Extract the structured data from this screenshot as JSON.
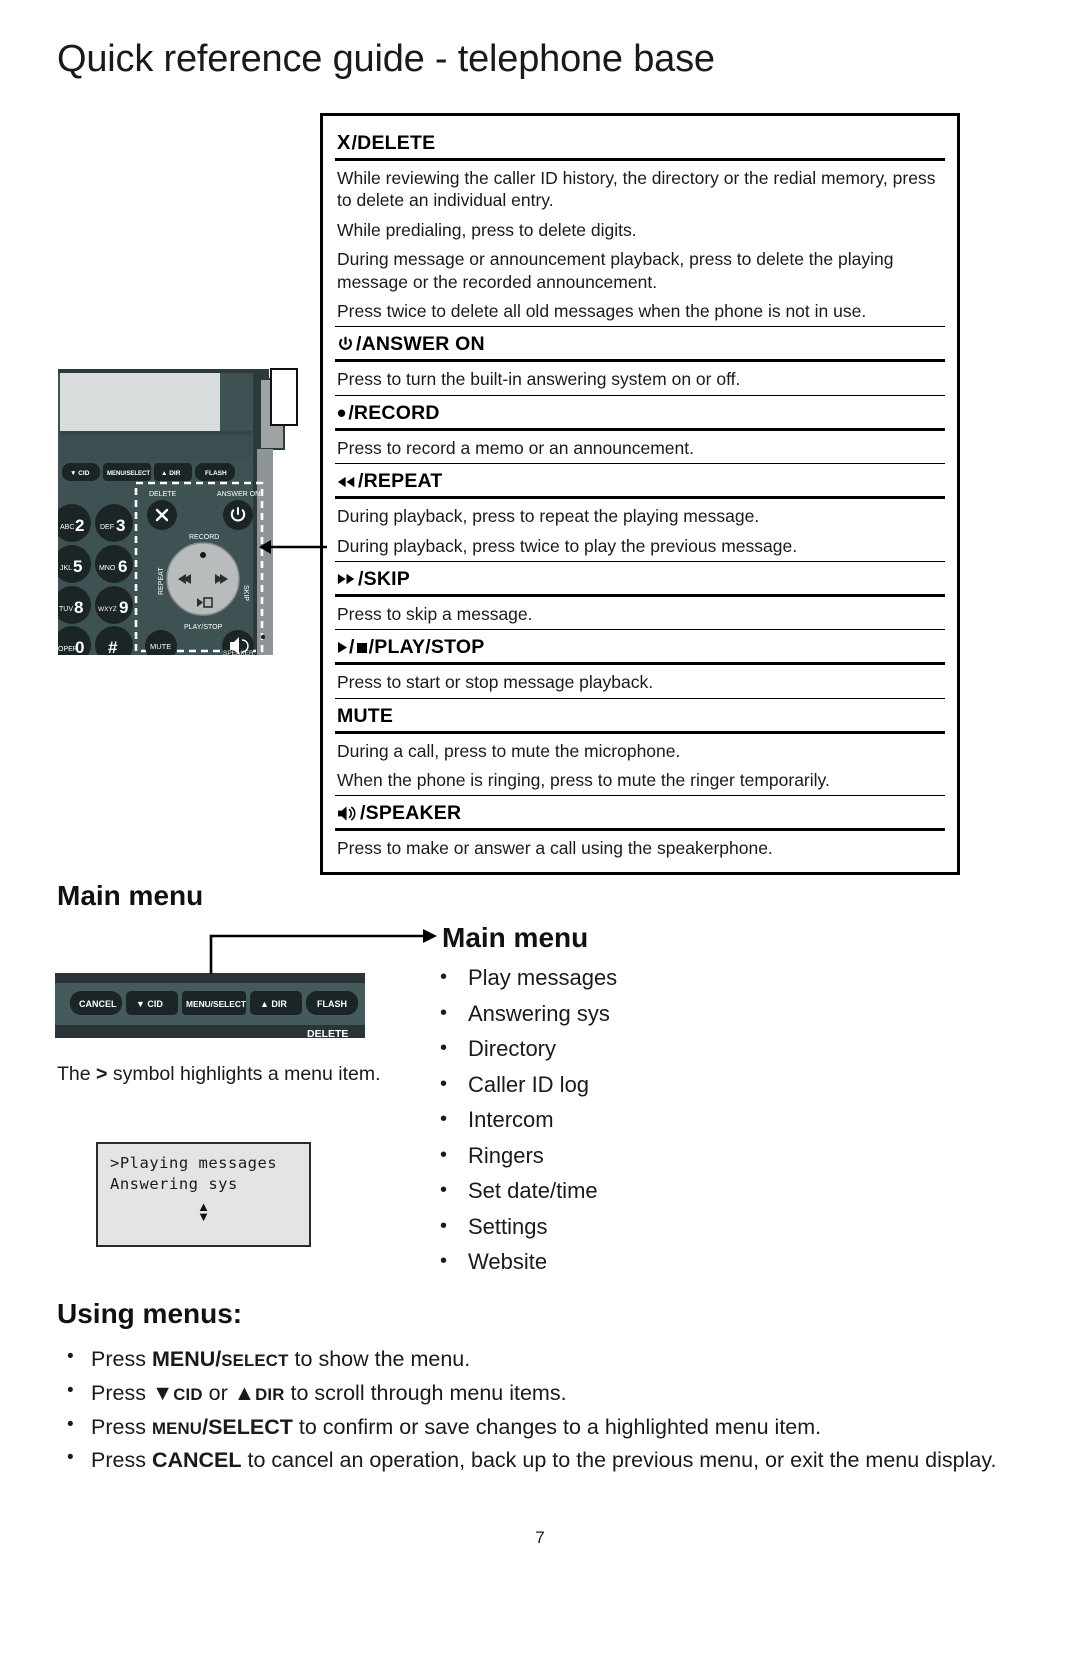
{
  "page": {
    "title": "Quick reference guide - telephone base",
    "number": "7"
  },
  "key_reference": {
    "entries": [
      {
        "icon": "x-delete-icon",
        "symbol": "X",
        "label": "/DELETE",
        "lines": [
          "While reviewing the caller ID history, the directory or the redial memory, press to delete an individual entry.",
          "While predialing, press to delete digits.",
          "During message or announcement playback, press to delete the playing message or the recorded announcement.",
          "Press twice to delete all old messages when the phone is not in use."
        ]
      },
      {
        "icon": "power-icon",
        "symbol": "⏻",
        "label": "/ANSWER ON",
        "lines": [
          "Press to turn the built-in answering system on or off."
        ]
      },
      {
        "icon": "record-dot-icon",
        "symbol": "•",
        "label": "/RECORD",
        "lines": [
          "Press to record a memo or an announcement."
        ]
      },
      {
        "icon": "rewind-icon",
        "symbol": "⏪",
        "label": "/REPEAT",
        "lines": [
          "During playback, press to repeat the playing message.",
          "During playback, press twice to play the previous message."
        ]
      },
      {
        "icon": "fast-forward-icon",
        "symbol": "⏩",
        "label": "/SKIP",
        "lines": [
          "Press to skip a message."
        ]
      },
      {
        "icon": "play-stop-icon",
        "symbol": "▶/■",
        "label": "/PLAY/STOP",
        "lines": [
          "Press to start or stop message playback."
        ]
      },
      {
        "icon": "mute-icon",
        "symbol": "",
        "label": "MUTE",
        "lines": [
          "During a call, press to mute the microphone.",
          "When the phone is ringing, press to mute the ringer temporarily."
        ]
      },
      {
        "icon": "speaker-icon",
        "symbol": "🔊",
        "label": "/SPEAKER",
        "lines": [
          "Press to make or answer a call using the speakerphone."
        ]
      }
    ]
  },
  "phone_illustration": {
    "soft_keys": [
      "▼ CID",
      "MENU/SELECT",
      "▲ DIR",
      "FLASH"
    ],
    "keypad": [
      {
        "digit": "2",
        "letters": "ABC"
      },
      {
        "digit": "3",
        "letters": "DEF"
      },
      {
        "digit": "5",
        "letters": "JKL"
      },
      {
        "digit": "6",
        "letters": "MNO"
      },
      {
        "digit": "8",
        "letters": "TUV"
      },
      {
        "digit": "9",
        "letters": "WXYZ"
      },
      {
        "digit": "0",
        "letters": "OPER"
      },
      {
        "digit": "#",
        "letters": ""
      }
    ],
    "labels": {
      "delete": "DELETE",
      "answer_on": "ANSWER ON",
      "record": "RECORD",
      "repeat": "REPEAT",
      "skip": "SKIP",
      "play_stop": "PLAY/STOP",
      "mute": "MUTE",
      "speaker": "SPEAKER"
    },
    "base_color": "#3e5153",
    "key_color": "#1c2526",
    "ring_color": "#b9bcbd"
  },
  "main_menu_section": {
    "heading": "Main menu",
    "callout_title": "Main menu",
    "items": [
      "Play messages",
      "Answering sys",
      "Directory",
      "Caller ID log",
      "Intercom",
      "Ringers",
      "Set date/time",
      "Settings",
      "Website"
    ],
    "note_prefix": "The ",
    "note_symbol": ">",
    "note_suffix": " symbol highlights a menu item.",
    "keystrip_buttons": [
      "CANCEL",
      "▼ CID",
      "MENU/SELECT",
      "▲ DIR",
      "FLASH"
    ],
    "keystrip_sublabel": "DELETE",
    "lcd": {
      "line1": ">Playing messages",
      "line2": " Answering sys",
      "scroll_up": "▲",
      "scroll_down": "▼"
    }
  },
  "using_menus": {
    "heading": "Using menus:",
    "bullets": [
      {
        "pre": "Press ",
        "key_big": "MENU/",
        "key_small": "SELECT",
        "post": " to show the menu."
      },
      {
        "pre": "Press ",
        "key_big": "▼",
        "key_small": "CID",
        "mid": " or ",
        "key_big2": "▲",
        "key_small2": "DIR",
        "post": " to scroll through menu items."
      },
      {
        "pre": "Press ",
        "key_small": "MENU",
        "key_big": "/SELECT",
        "post": " to confirm or save changes to a highlighted menu item."
      },
      {
        "pre": "Press ",
        "key_big": "CANCEL",
        "post": " to cancel an operation, back up to the previous menu, or exit the menu display."
      }
    ]
  }
}
